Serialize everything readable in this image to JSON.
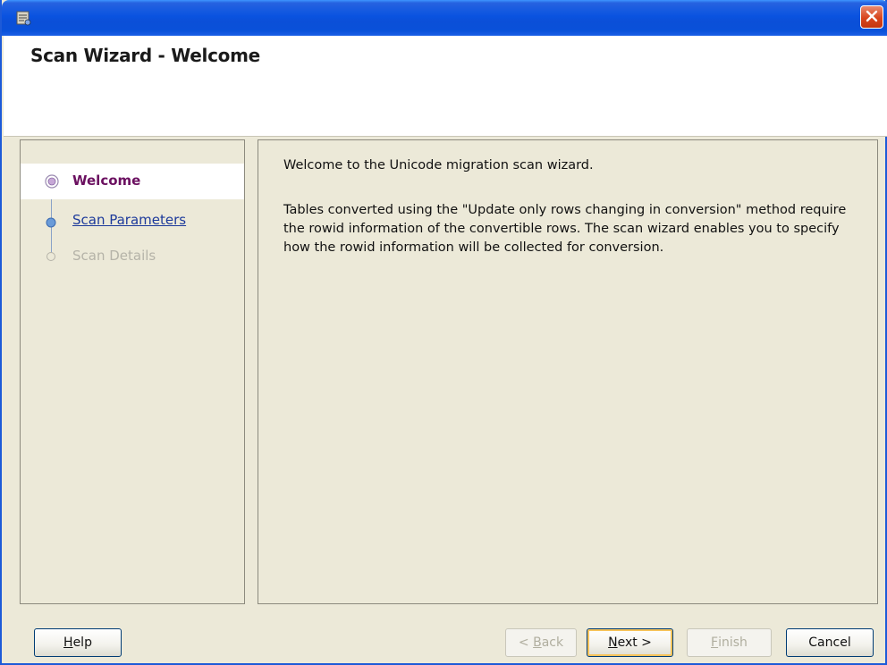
{
  "window": {
    "icon": "wizard-app-icon",
    "close_icon": "close-icon"
  },
  "header": {
    "title": "Scan Wizard - Welcome"
  },
  "steps": [
    {
      "label": "Welcome",
      "state": "current"
    },
    {
      "label": "Scan Parameters",
      "state": "link"
    },
    {
      "label": "Scan Details",
      "state": "disabled"
    }
  ],
  "content": {
    "paragraph1": "Welcome to the Unicode migration scan wizard.",
    "paragraph2": "Tables converted using the \"Update only rows changing in conversion\" method require the rowid information of the convertible rows. The scan wizard enables you to specify how the rowid information will be collected for conversion."
  },
  "buttons": {
    "help": {
      "mnemonic": "H",
      "rest": "elp"
    },
    "back": {
      "prefix": "< ",
      "mnemonic": "B",
      "rest": "ack"
    },
    "next": {
      "mnemonic": "N",
      "rest": "ext >"
    },
    "finish": {
      "mnemonic": "F",
      "rest": "inish"
    },
    "cancel": {
      "label": "Cancel"
    }
  },
  "colors": {
    "titlebar": "#0a53e0",
    "current_step": "#6b1060",
    "link_step": "#1d3a9b",
    "disabled": "#b5b3a8"
  }
}
